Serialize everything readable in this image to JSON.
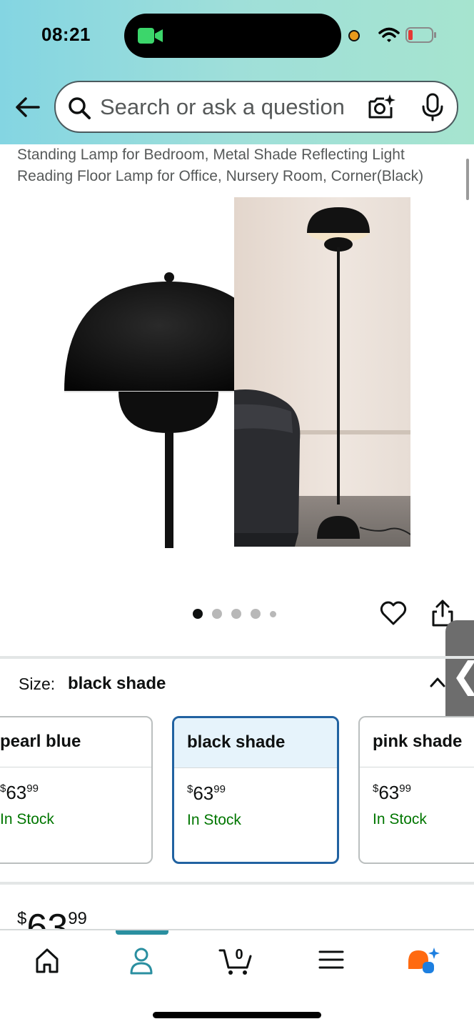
{
  "status_bar": {
    "time": "08:21"
  },
  "search": {
    "placeholder": "Search or ask a question"
  },
  "product": {
    "title": "Standing Lamp for Bedroom, Metal Shade Reflecting Light Reading Floor Lamp for Office, Nursery Room, Corner(Black)",
    "image_count": 5,
    "active_image_index": 0
  },
  "size": {
    "label": "Size:",
    "selected": "black shade",
    "options": [
      {
        "name": "pearl blue",
        "price_symbol": "$",
        "price_whole": "63",
        "price_fraction": "99",
        "stock": "In Stock"
      },
      {
        "name": "black shade",
        "price_symbol": "$",
        "price_whole": "63",
        "price_fraction": "99",
        "stock": "In Stock"
      },
      {
        "name": "pink shade",
        "price_symbol": "$",
        "price_whole": "63",
        "price_fraction": "99",
        "stock": "In Stock"
      }
    ]
  },
  "price": {
    "symbol": "$",
    "whole": "63",
    "fraction": "99"
  },
  "side_tab": {
    "glyph": "❮"
  },
  "bottom_nav": {
    "items": [
      "home-icon",
      "account-icon",
      "cart-icon",
      "menu-icon",
      "rufus-ai-icon"
    ],
    "active": "account-icon",
    "cart_count": "0"
  },
  "colors": {
    "accent": "#2162a1",
    "in_stock": "#007600",
    "nav_active": "#2a8fa0"
  }
}
